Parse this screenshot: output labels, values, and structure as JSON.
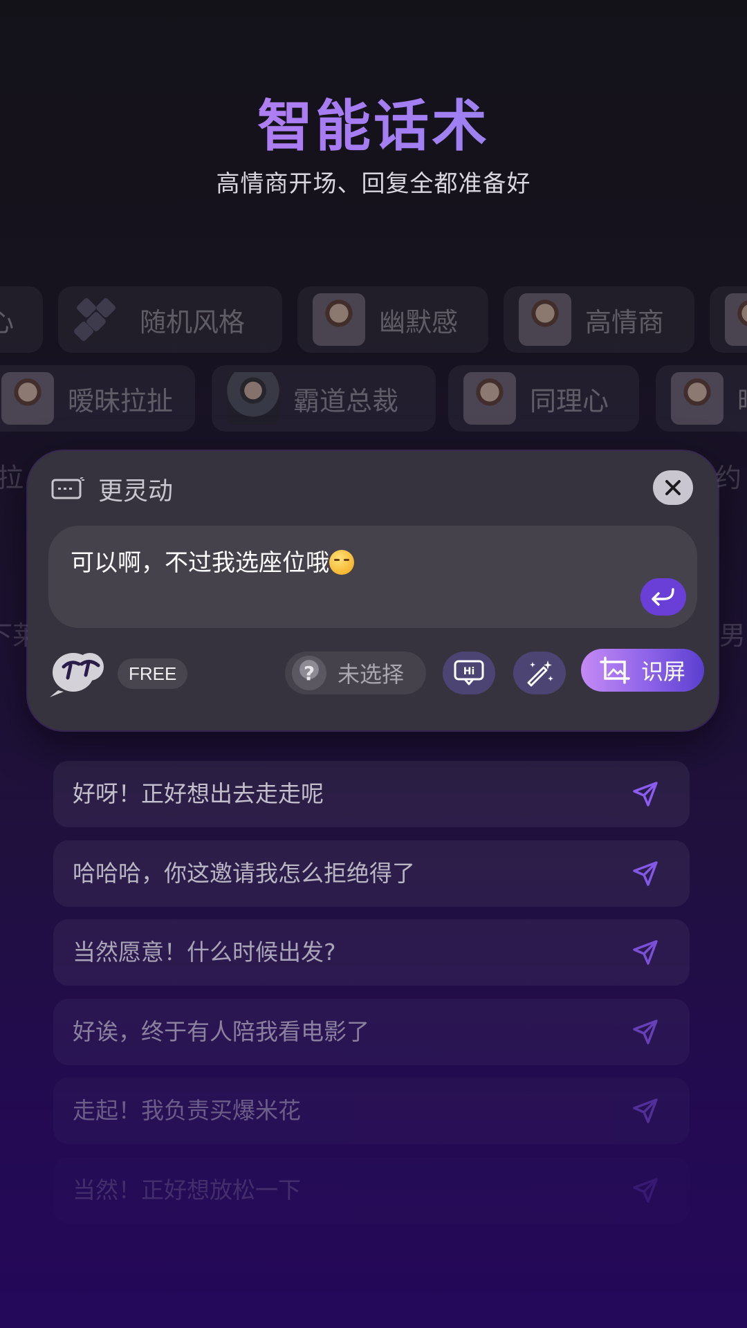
{
  "hero": {
    "title": "智能话术",
    "subtitle": "高情商开场、回复全都准备好"
  },
  "style_chips_row1": [
    {
      "label": "心",
      "icon": "none"
    },
    {
      "label": "随机风格",
      "icon": "dice-icon"
    },
    {
      "label": "幽默感",
      "icon": "avatar"
    },
    {
      "label": "高情商",
      "icon": "avatar"
    }
  ],
  "style_chips_row2": [
    {
      "label": "暧昧拉扯",
      "icon": "avatar"
    },
    {
      "label": "霸道总裁",
      "icon": "avatar"
    },
    {
      "label": "同理心",
      "icon": "avatar"
    },
    {
      "label": "暗",
      "icon": "avatar"
    }
  ],
  "ghost_row": {
    "left_a": "拉",
    "left_b": "下莱",
    "right_a": "约",
    "right_b": "男"
  },
  "panel": {
    "mode_label": "更灵动",
    "input_text": "可以啊，不过我选座位哦",
    "free_label": "FREE",
    "persona_label": "未选择",
    "persona_icon_text": "?",
    "screen_label": "识屏",
    "hi_icon_text": "Hi"
  },
  "suggestions": [
    {
      "text": "好呀！正好想出去走走呢",
      "opacity": 1.0
    },
    {
      "text": "哈哈哈，你这邀请我怎么拒绝得了",
      "opacity": 0.95
    },
    {
      "text": "当然愿意！什么时候出发?",
      "opacity": 0.85
    },
    {
      "text": "好诶，终于有人陪我看电影了",
      "opacity": 0.65
    },
    {
      "text": "走起！我负责买爆米花",
      "opacity": 0.45
    },
    {
      "text": "当然！正好想放松一下",
      "opacity": 0.2
    }
  ],
  "colors": {
    "accent": "#8d63e8",
    "send_icon": "#8a5cf0",
    "panel_bg": "#37333e"
  }
}
